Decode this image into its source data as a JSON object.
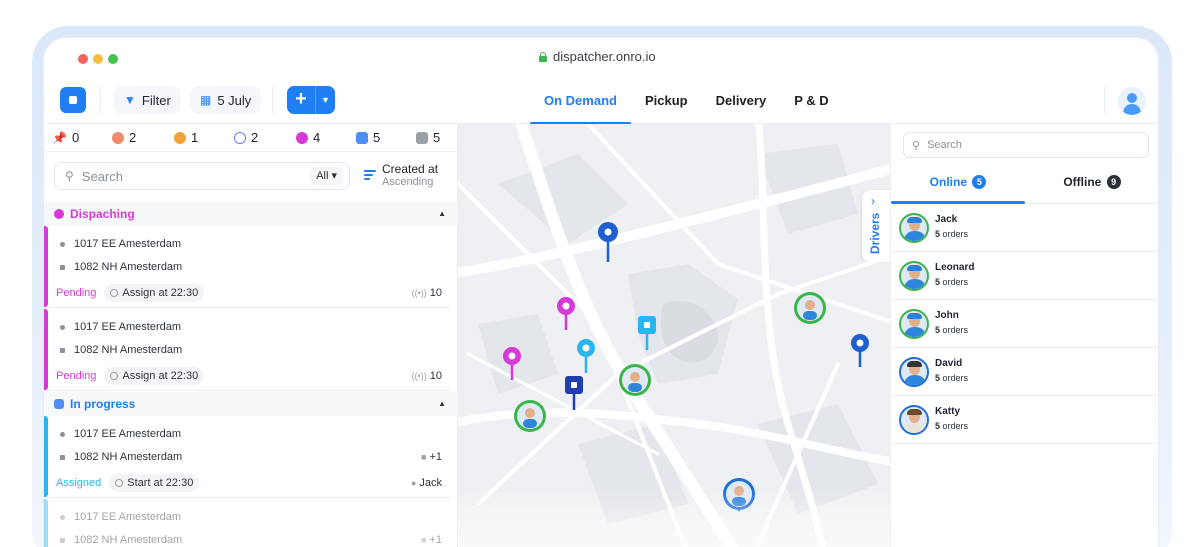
{
  "window": {
    "url": "dispatcher.onro.io"
  },
  "toolbar": {
    "filter_label": "Filter",
    "date_label": "5 July",
    "tabs": [
      "On Demand",
      "Pickup",
      "Delivery",
      "P & D"
    ],
    "active_tab": "On Demand"
  },
  "stats": [
    "0",
    "2",
    "1",
    "2",
    "4",
    "5",
    "5"
  ],
  "left": {
    "search_placeholder": "Search",
    "filter_value": "All",
    "sort_label": "Created at",
    "sort_order": "Ascending",
    "groups": [
      {
        "title": "Dispaching",
        "color": "#d63ad6",
        "orders": [
          {
            "pickup": "1017 EE Amesterdam",
            "dropoff": "1082 NH Amesterdam",
            "status": "Pending",
            "schedule": "Assign at 22:30",
            "count": "10"
          },
          {
            "pickup": "1017 EE Amesterdam",
            "dropoff": "1082 NH Amesterdam",
            "status": "Pending",
            "schedule": "Assign at 22:30",
            "count": "10"
          }
        ]
      },
      {
        "title": "In progress",
        "color": "#1f7ef2",
        "orders": [
          {
            "pickup": "1017 EE Amesterdam",
            "dropoff": "1082 NH Amesterdam",
            "extra": "+1",
            "status": "Assigned",
            "schedule": "Start at 22:30",
            "driver": "Jack"
          },
          {
            "pickup": "1017 EE Amesterdam",
            "dropoff": "1082 NH Amesterdam",
            "extra": "+1"
          }
        ]
      }
    ]
  },
  "map": {
    "drivers_tab_label": "Drivers"
  },
  "right": {
    "search_placeholder": "Search",
    "tabs": [
      {
        "label": "Online",
        "count": "5"
      },
      {
        "label": "Offline",
        "count": "9"
      }
    ],
    "drivers": [
      {
        "name": "Jack",
        "orders": "5",
        "orders_suffix": "orders",
        "ring": "#3ab54a"
      },
      {
        "name": "Leonard",
        "orders": "5",
        "orders_suffix": "orders",
        "ring": "#3ab54a"
      },
      {
        "name": "John",
        "orders": "5",
        "orders_suffix": "orders",
        "ring": "#3ab54a"
      },
      {
        "name": "David",
        "orders": "5",
        "orders_suffix": "orders",
        "ring": "#1f6fd6"
      },
      {
        "name": "Katty",
        "orders": "5",
        "orders_suffix": "orders",
        "ring": "#1f6fd6"
      }
    ]
  },
  "colors": {
    "accent": "#1f7ef2",
    "dispatching": "#d63ad6",
    "in_progress": "#2bb5f0",
    "online_ring": "#3ab54a",
    "busy_ring": "#1f6fd6"
  }
}
